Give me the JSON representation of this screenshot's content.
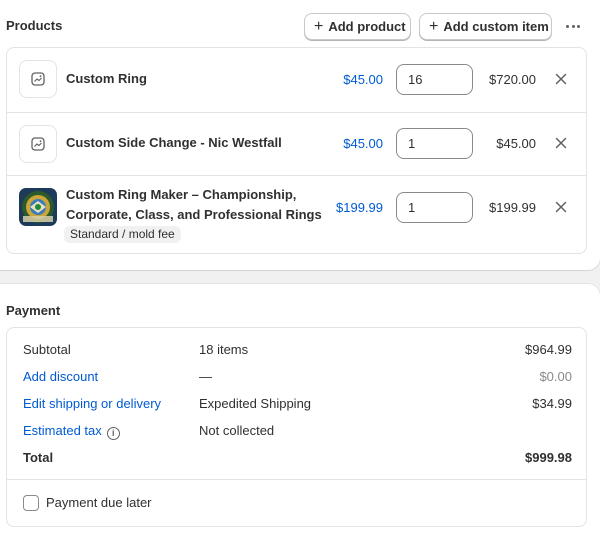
{
  "products": {
    "title": "Products",
    "add_product_label": "Add product",
    "add_custom_item_label": "Add custom item",
    "more_icon": "horizontal-dots-icon",
    "items": [
      {
        "name": "Custom Ring",
        "image": "placeholder-image-icon",
        "price": "$45.00",
        "quantity": "16",
        "total": "$720.00"
      },
      {
        "name": "Custom Side Change - Nic Westfall",
        "image": "placeholder-image-icon",
        "price": "$45.00",
        "quantity": "1",
        "total": "$45.00"
      },
      {
        "name_line1": "Custom Ring Maker – Championship,",
        "name_line2": "Corporate, Class, and Professional Rings",
        "image": "ring-product-photo",
        "variant": "Standard / mold fee",
        "price": "$199.99",
        "quantity": "1",
        "total": "$199.99"
      }
    ]
  },
  "payment": {
    "title": "Payment",
    "subtotal": {
      "label": "Subtotal",
      "detail": "18 items",
      "amount": "$964.99"
    },
    "discount": {
      "label": "Add discount",
      "detail": "—",
      "amount": "$0.00"
    },
    "shipping": {
      "label": "Edit shipping or delivery",
      "detail": "Expedited Shipping",
      "amount": "$34.99"
    },
    "tax": {
      "label": "Estimated tax",
      "detail": "Not collected",
      "icon": "info-icon"
    },
    "total": {
      "label": "Total",
      "amount": "$999.98"
    },
    "due_later": {
      "label": "Payment due later",
      "checked": false
    }
  },
  "colors": {
    "link": "#005bd3",
    "text": "#303030",
    "muted": "#8a8a8a",
    "border": "#e3e3e3",
    "background": "#f1f1f1"
  }
}
